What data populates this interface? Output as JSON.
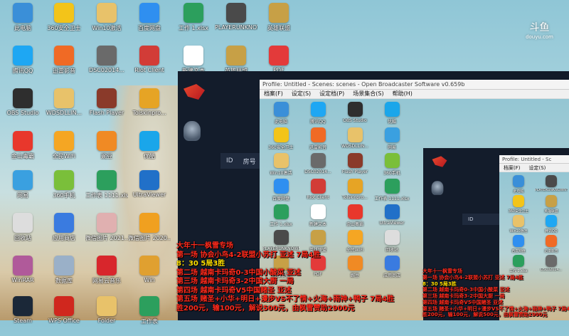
{
  "watermark": {
    "brand": "斗鱼",
    "sub": "douyu.com"
  },
  "desktop_icons": [
    {
      "label": "此电脑",
      "color": "#3a8fd8"
    },
    {
      "label": "360安全卫士",
      "color": "#f3c419"
    },
    {
      "label": "Win10激活",
      "color": "#e8c26a"
    },
    {
      "label": "百度网盘",
      "color": "#2f8ff0"
    },
    {
      "label": "工作\n1.xlsx",
      "color": "#2c9f5d"
    },
    {
      "label": "PLAYERUNKNOWN'S",
      "color": "#4a4a4a"
    },
    {
      "label": "英雄联盟",
      "color": "#c7a046"
    },
    {
      "label": "腾讯QQ",
      "color": "#1ea7f3"
    },
    {
      "label": "迅雷影音",
      "color": "#f06a25"
    },
    {
      "label": "DSC02014...",
      "color": "#6a6a6a"
    },
    {
      "label": "Riot Client",
      "color": "#d23c37"
    },
    {
      "label": "新建文本",
      "color": "#ffffff"
    },
    {
      "label": "英雄联盟",
      "color": "#c7a046"
    },
    {
      "label": "PDF",
      "color": "#e33a3a"
    },
    {
      "label": "OBS Studio",
      "color": "#2e2e2e"
    },
    {
      "label": "WDSDLLIN...",
      "color": "#e8c26a"
    },
    {
      "label": "Flash Player",
      "color": "#8a3a2a"
    },
    {
      "label": "Tolskinpro...",
      "color": "#e6a425"
    },
    {
      "label": "金山毒霸",
      "color": "#e8372c"
    },
    {
      "label": "全民WiFi",
      "color": "#f5a623"
    },
    {
      "label": "豌豆",
      "color": "#f08a24"
    },
    {
      "label": "优酷",
      "color": "#1aa6ea"
    },
    {
      "label": "网易",
      "color": "#3aa0e0"
    },
    {
      "label": "360手机",
      "color": "#7abf3a"
    },
    {
      "label": "工作表\n1111.xlsx",
      "color": "#2c9f5d"
    },
    {
      "label": "UltraViewer",
      "color": "#2170c8"
    },
    {
      "label": "回收站",
      "color": "#dddddd"
    },
    {
      "label": "应用商店",
      "color": "#3a7be0"
    },
    {
      "label": "微信图片\n2021...",
      "color": "#e0b0b0"
    },
    {
      "label": "微信图片\n2020...",
      "color": "#f0a020"
    },
    {
      "label": "WinRAR",
      "color": "#b05a9a"
    },
    {
      "label": "数据库",
      "color": "#9ab0c8"
    },
    {
      "label": "网易云音乐",
      "color": "#d8262c"
    },
    {
      "label": "Win",
      "color": "#e0a030"
    },
    {
      "label": "Steam",
      "color": "#1b2838"
    },
    {
      "label": "WPS Office",
      "color": "#d0271e"
    },
    {
      "label": "Folder",
      "color": "#e8c26a"
    },
    {
      "label": "工作表",
      "color": "#2c9f5d"
    }
  ],
  "obs_window": {
    "title": "Profile: Untitled - Scenes: scenes - Open Broadcaster Software v0.659b",
    "menu": [
      "档案(F)",
      "设定(S)",
      "设定档(P)",
      "场景集合(S)",
      "帮助(H)"
    ],
    "table_headers": [
      "ID",
      "房号"
    ]
  },
  "obs_window_nested": {
    "title": "Profile: Untitled - Sc"
  },
  "overlay_lines": [
    {
      "text": "大年十一枫雪专场",
      "cls": ""
    },
    {
      "text": "第一场  协会小鸟4-2联盟小苏打  亚述  7局4胜",
      "cls": ""
    },
    {
      "text": "8：30    5局3胜",
      "cls": "y"
    },
    {
      "text": "第二场  越南卡玛奇0-3中国小酸菜  亚述",
      "cls": ""
    },
    {
      "text": "第三场  越南卡玛奇3-2中国大厨  一局",
      "cls": ""
    },
    {
      "text": "第四场  越南卡玛奇V5中国赌圣  亚述",
      "cls": ""
    },
    {
      "text": "第五场  赌圣+小华+明日+漫步VS不了情+火海+雨神+鸭子  7局4胜",
      "cls": ""
    },
    {
      "text": "胜200元，输100元，解说500元，由枫雪赞助2900元",
      "cls": ""
    }
  ]
}
